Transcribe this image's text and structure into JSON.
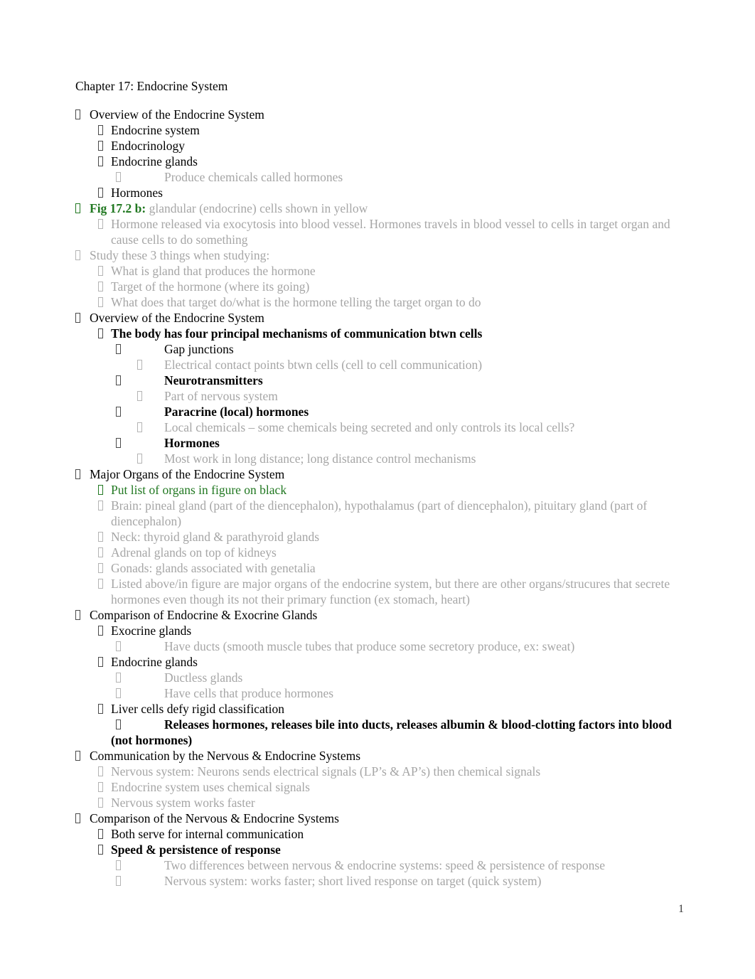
{
  "document": {
    "title": "Chapter 17: Endocrine System",
    "page_number": "1",
    "colors": {
      "body_text": "#000000",
      "secondary_text": "#a6a6a6",
      "highlight_green": "#217821"
    },
    "bullet_icon": "missing-glyph-box"
  },
  "outline": [
    {
      "level": 1,
      "color": "black",
      "bold": false,
      "text": "Overview of the Endocrine System"
    },
    {
      "level": 2,
      "color": "black",
      "bold": false,
      "text": "Endocrine system"
    },
    {
      "level": 2,
      "color": "black",
      "bold": false,
      "text": "Endocrinology"
    },
    {
      "level": 2,
      "color": "black",
      "bold": false,
      "text": "Endocrine glands"
    },
    {
      "level": 3,
      "color": "grey",
      "bold": false,
      "text": "Produce chemicals called hormones"
    },
    {
      "level": 2,
      "color": "black",
      "bold": false,
      "text": "Hormones"
    },
    {
      "level": 1,
      "color": "mixed",
      "bold": false,
      "lead": "Fig 17.2 b:",
      "lead_color": "green",
      "lead_bold": true,
      "text": " glandular (endocrine) cells shown in yellow",
      "text_color": "grey"
    },
    {
      "level": 2,
      "color": "grey",
      "bold": false,
      "text": "Hormone released via exocytosis into blood vessel. Hormones travels in blood vessel to cells in target organ and cause cells to do something"
    },
    {
      "level": 1,
      "color": "grey",
      "bold": false,
      "text": "Study these 3 things when studying:"
    },
    {
      "level": 2,
      "color": "grey",
      "bold": false,
      "text": "What is gland that produces the hormone"
    },
    {
      "level": 2,
      "color": "grey",
      "bold": false,
      "text": "Target of the hormone (where its going)"
    },
    {
      "level": 2,
      "color": "grey",
      "bold": false,
      "text": "What does that target do/what is the hormone telling the target organ to do"
    },
    {
      "level": 1,
      "color": "black",
      "bold": false,
      "text": "Overview of the Endocrine System"
    },
    {
      "level": 2,
      "color": "black",
      "bold": true,
      "text": "The body has four principal mechanisms of communication btwn cells"
    },
    {
      "level": 3,
      "color": "black",
      "bold": false,
      "text": "Gap junctions"
    },
    {
      "level": 4,
      "color": "grey",
      "bold": false,
      "text": "Electrical contact points btwn cells (cell to cell communication)"
    },
    {
      "level": 3,
      "color": "black",
      "bold": true,
      "text": "Neurotransmitters"
    },
    {
      "level": 4,
      "color": "grey",
      "bold": false,
      "text": "Part of nervous system"
    },
    {
      "level": 3,
      "color": "black",
      "bold": true,
      "text": "Paracrine (local) hormones"
    },
    {
      "level": 4,
      "color": "grey",
      "bold": false,
      "text": "Local chemicals – some chemicals being secreted and only controls its local cells?"
    },
    {
      "level": 3,
      "color": "black",
      "bold": true,
      "text": "Hormones"
    },
    {
      "level": 4,
      "color": "grey",
      "bold": false,
      "text": "Most work in long distance; long distance control mechanisms"
    },
    {
      "level": 1,
      "color": "black",
      "bold": false,
      "text": "Major Organs of the Endocrine System"
    },
    {
      "level": 2,
      "color": "green",
      "bold": false,
      "text": "Put list of organs in figure on black"
    },
    {
      "level": 2,
      "color": "grey",
      "bold": false,
      "text": "Brain: pineal gland (part of the diencephalon), hypothalamus (part of diencephalon), pituitary gland (part of diencephalon)"
    },
    {
      "level": 2,
      "color": "grey",
      "bold": false,
      "text": "Neck: thyroid gland & parathyroid glands"
    },
    {
      "level": 2,
      "color": "grey",
      "bold": false,
      "text": "Adrenal glands on top of kidneys"
    },
    {
      "level": 2,
      "color": "grey",
      "bold": false,
      "text": "Gonads: glands associated with genetalia"
    },
    {
      "level": 2,
      "color": "grey",
      "bold": false,
      "text": "Listed above/in figure are major organs of the endocrine system, but there are other organs/strucures that secrete hormones even though its not their primary function (ex stomach, heart)"
    },
    {
      "level": 1,
      "color": "black",
      "bold": false,
      "text": "Comparison of Endocrine & Exocrine Glands"
    },
    {
      "level": 2,
      "color": "black",
      "bold": false,
      "text": "Exocrine glands"
    },
    {
      "level": 3,
      "color": "grey",
      "bold": false,
      "text": "Have ducts (smooth muscle tubes that produce some secretory produce, ex: sweat)"
    },
    {
      "level": 2,
      "color": "black",
      "bold": false,
      "text": "Endocrine glands"
    },
    {
      "level": 3,
      "color": "grey",
      "bold": false,
      "text": "Ductless glands"
    },
    {
      "level": 3,
      "color": "grey",
      "bold": false,
      "text": "Have cells that produce hormones"
    },
    {
      "level": 2,
      "color": "black",
      "bold": false,
      "text": "Liver cells defy rigid classification"
    },
    {
      "level": 3,
      "color": "black",
      "bold": true,
      "text": "Releases hormones, releases bile into ducts, releases albumin & blood-clotting factors into blood (not hormones)"
    },
    {
      "level": 1,
      "color": "black",
      "bold": false,
      "text": "Communication by the Nervous & Endocrine Systems"
    },
    {
      "level": 2,
      "color": "grey",
      "bold": false,
      "text": "Nervous system: Neurons sends electrical signals (LP’s & AP’s) then chemical signals"
    },
    {
      "level": 2,
      "color": "grey",
      "bold": false,
      "text": "Endocrine system uses chemical signals"
    },
    {
      "level": 2,
      "color": "grey",
      "bold": false,
      "text": "Nervous system works faster"
    },
    {
      "level": 1,
      "color": "black",
      "bold": false,
      "text": "Comparison of the Nervous & Endocrine Systems"
    },
    {
      "level": 2,
      "color": "black",
      "bold": false,
      "text": "Both serve for internal communication"
    },
    {
      "level": 2,
      "color": "black",
      "bold": true,
      "text": "Speed & persistence of response"
    },
    {
      "level": 3,
      "color": "grey",
      "bold": false,
      "text": "Two differences between nervous & endocrine systems: speed & persistence of response"
    },
    {
      "level": 3,
      "color": "grey",
      "bold": false,
      "text": "Nervous system: works faster; short lived response on target (quick system)"
    }
  ]
}
